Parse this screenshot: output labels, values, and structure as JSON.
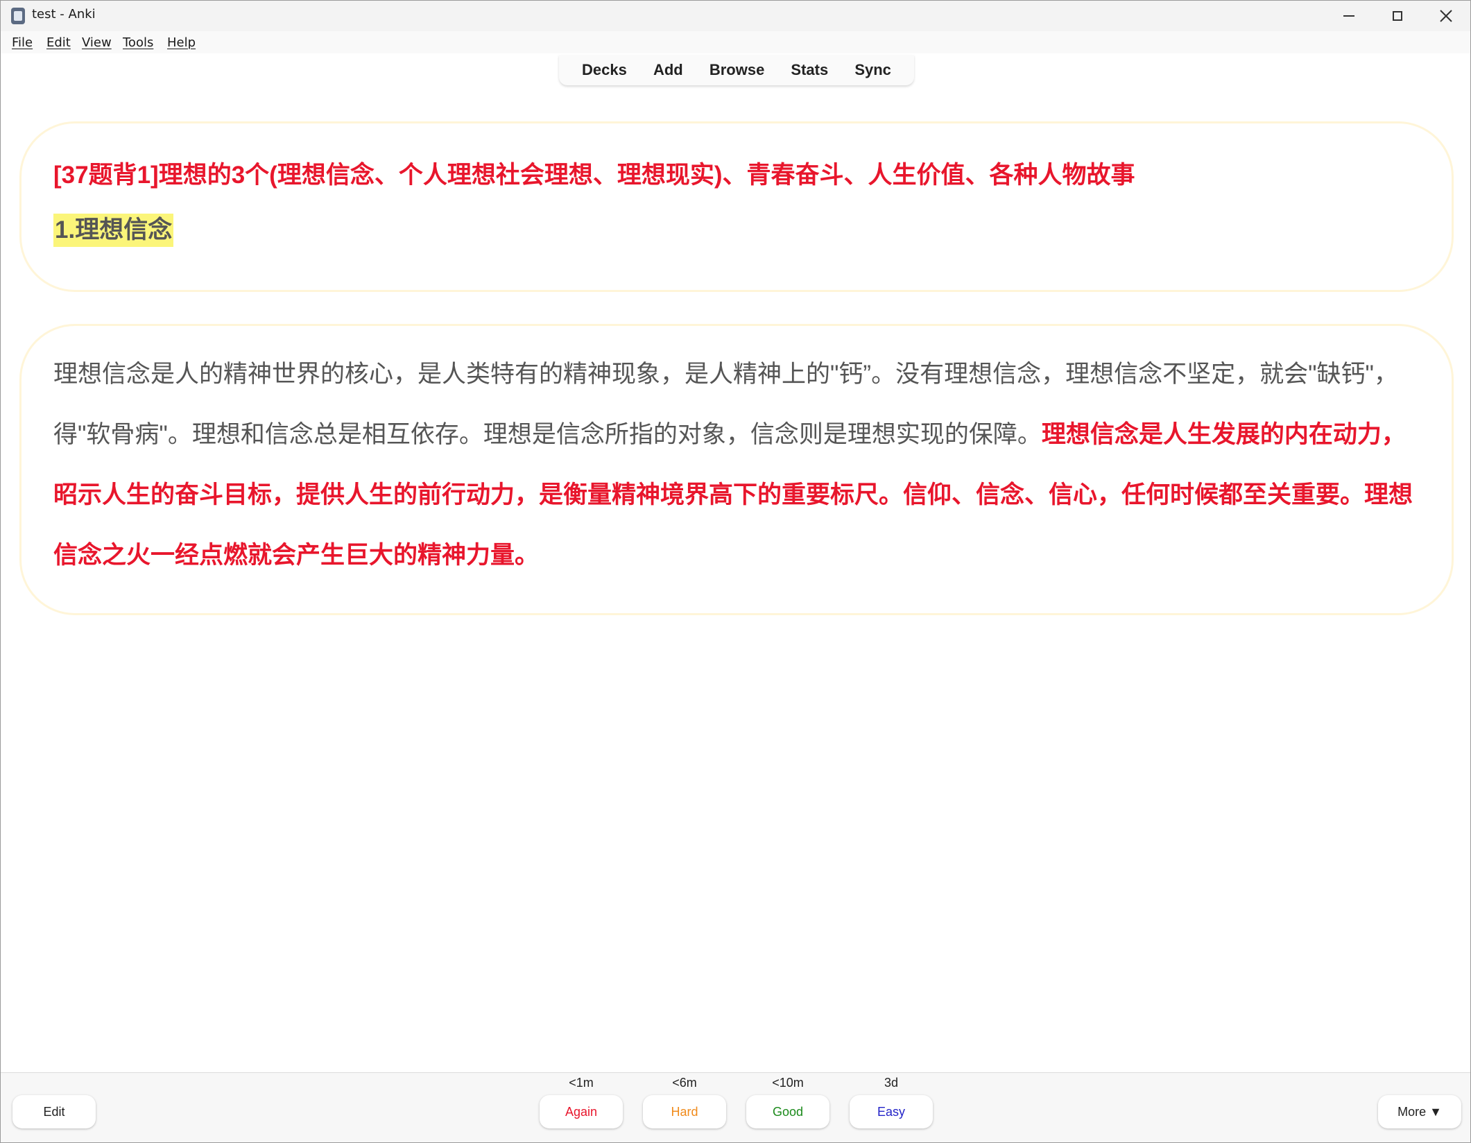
{
  "window": {
    "title": "test - Anki",
    "icon": "anki-app-icon"
  },
  "menubar": {
    "items": [
      "File",
      "Edit",
      "View",
      "Tools",
      "Help"
    ]
  },
  "toolbar": {
    "links": [
      "Decks",
      "Add",
      "Browse",
      "Stats",
      "Sync"
    ]
  },
  "card": {
    "front_title": "[37题背1]理想的3个(理想信念、个人理想社会理想、理想现实)、青春奋斗、人生价值、各种人物故事",
    "front_subtitle": "1.理想信念",
    "back_plain": "理想信念是人的精神世界的核心，是人类特有的精神现象，是人精神上的\"钙”。没有理想信念，理想信念不坚定，就会\"缺钙\"，得\"软骨病\"。理想和信念总是相互依存。理想是信念所指的对象，信念则是理想实现的保障。",
    "back_highlight": "理想信念是人生发展的内在动力，昭示人生的奋斗目标，提供人生的前行动力，是衡量精神境界高下的重要标尺。信仰、信念、信心，任何时候都至关重要。理想信念之火一经点燃就会产生巨大的精神力量。",
    "colors": {
      "highlight_red": "#e8162c",
      "marker_yellow": "#fbf57a",
      "body_gray": "#555555",
      "card_border": "#fff5d8"
    }
  },
  "bottom": {
    "edit_label": "Edit",
    "more_label": "More ▼",
    "answers": [
      {
        "label": "Again",
        "time": "<1m",
        "color": "#e8162c"
      },
      {
        "label": "Hard",
        "time": "<6m",
        "color": "#f08a1a"
      },
      {
        "label": "Good",
        "time": "<10m",
        "color": "#1b8a1b"
      },
      {
        "label": "Easy",
        "time": "3d",
        "color": "#2323c8"
      }
    ]
  }
}
